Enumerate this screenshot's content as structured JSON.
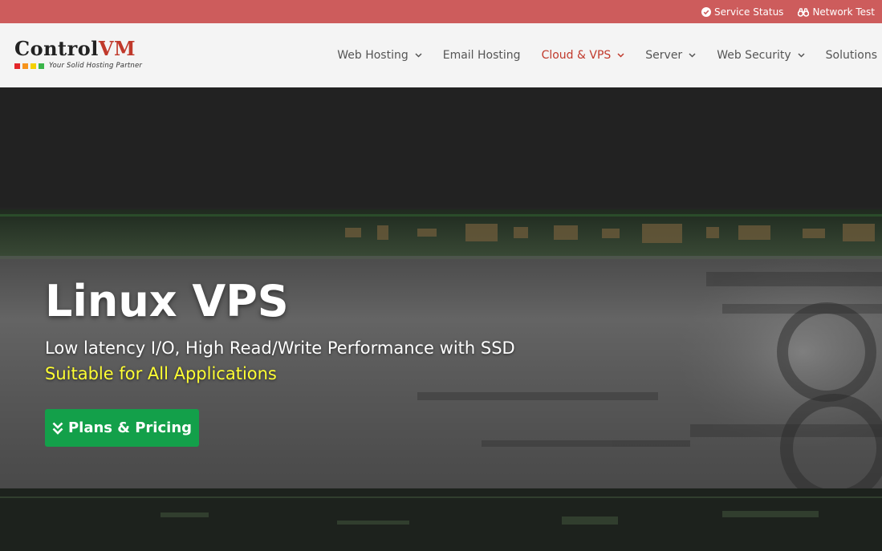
{
  "topbar": {
    "service_status": "Service Status",
    "network_test": "Network Test"
  },
  "logo": {
    "part1": "Control",
    "part2": "VM",
    "tagline": "Your Solid Hosting Partner",
    "squares": [
      "#e3262a",
      "#f7941d",
      "#f4d000",
      "#3ab54a"
    ]
  },
  "nav": {
    "items": [
      {
        "label": "Web Hosting",
        "dropdown": true
      },
      {
        "label": "Email Hosting",
        "dropdown": false
      },
      {
        "label": "Cloud & VPS",
        "dropdown": true,
        "active": true
      },
      {
        "label": "Server",
        "dropdown": true
      },
      {
        "label": "Web Security",
        "dropdown": true
      },
      {
        "label": "Solutions",
        "dropdown": false
      }
    ]
  },
  "hero": {
    "title": "Linux VPS",
    "subtitle": "Low latency I/O, High Read/Write Performance with SSD",
    "subtitle2": "Suitable for All Applications",
    "cta_label": "Plans & Pricing",
    "cta_icon": "double-chevron-down-icon"
  },
  "colors": {
    "topbar": "#cd5c5c",
    "accent": "#c0392b",
    "cta": "#13a04a",
    "highlight": "#ffff33"
  }
}
